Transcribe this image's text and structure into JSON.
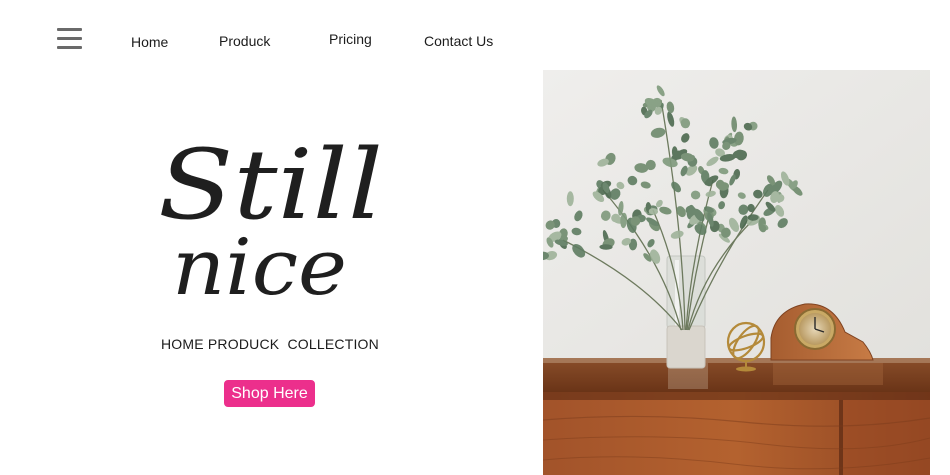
{
  "nav": {
    "menu_icon": "hamburger-menu-icon",
    "links": [
      {
        "label": "Home"
      },
      {
        "label": "Produck"
      },
      {
        "label": "Pricing"
      },
      {
        "label": "Contact Us"
      }
    ]
  },
  "hero": {
    "title_line1": "Still",
    "title_line2": "nice",
    "subtitle": "HOME PRODUCK  COLLECTION",
    "cta_label": "Shop Here"
  },
  "photo": {
    "subject": "eucalyptus bouquet in glass vase with gold clock and brass orb on a wooden dresser"
  },
  "colors": {
    "background": "#ffffff",
    "text": "#1c1c1c",
    "menu_icon": "#6a6a6a",
    "cta": "#ec2f8c",
    "cta_text": "#ffffff"
  }
}
